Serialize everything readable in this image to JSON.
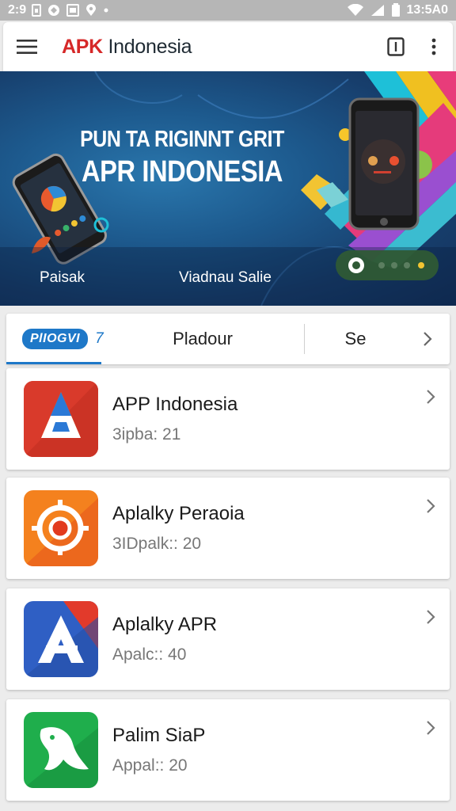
{
  "status_bar": {
    "left_time": "2:9",
    "right_time": "13:5A0",
    "icons": [
      "sim-icon",
      "notification-icon",
      "gallery-icon",
      "location-icon",
      "wifi-icon",
      "signal-icon",
      "battery-icon"
    ]
  },
  "app_bar": {
    "brand_red": "APK",
    "brand_dark": " Indonesia",
    "icons": [
      "menu-icon",
      "window-icon",
      "more-vert-icon"
    ]
  },
  "banner": {
    "line1": "PUN TA RIGINNT GRIT",
    "line2": "APR INDONESIA",
    "caption_left": "Paisak",
    "caption_right": "Viadnau Salie"
  },
  "tabs": {
    "badge": "PlΙΟGVI",
    "badge_num": "7",
    "tab2": "Pladour",
    "tab3": "Se"
  },
  "apps": [
    {
      "name": "APP Indonesia",
      "meta": "3ipba: 21",
      "icon": "triangle-logo-icon"
    },
    {
      "name": "Aplalky Peraoia",
      "meta": "3IDpalk:: 20",
      "icon": "target-logo-icon"
    },
    {
      "name": "Aplalky APR",
      "meta": "Apalc:: 40",
      "icon": "a-logo-icon"
    },
    {
      "name": "Palim SiaP",
      "meta": "Appal:: 20",
      "icon": "fish-logo-icon"
    }
  ],
  "colors": {
    "accent": "#1e78c8",
    "brand_red": "#d62828",
    "status_bar": "#b6b6b6"
  }
}
